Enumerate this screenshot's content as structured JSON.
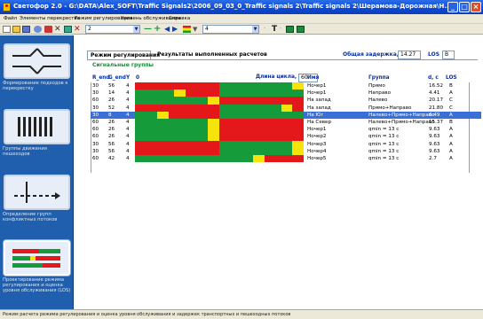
{
  "window": {
    "title": "Светофор 2.0 - G:\\DATA\\Alex_SOFT\\Traffic Signals2\\2006_09_03_0_Traffic signals 2\\Traffic signals 2\\Шерамова-Дорожная\\Н..."
  },
  "menu": [
    "Файл",
    "Элементы перекрестка",
    "Режим регулирования",
    "Уровень обслуживания",
    "Справка"
  ],
  "toolbar": {
    "combo1_value": "2",
    "combo2_value": "4"
  },
  "sidebar": [
    {
      "label": "Формирование подходов к перекрестку"
    },
    {
      "label": "Группы движения пешеходов"
    },
    {
      "label": "Определение групп конфликтных потоков"
    },
    {
      "label": "Проектирование режима регулирования и оценка уровня обслуживания (LOS)"
    }
  ],
  "tabs": {
    "active": "Режим регулирования",
    "results": "Результаты выполненных расчетов"
  },
  "summary": {
    "delay_label": "Общая задержка, с",
    "delay_value": "14.27",
    "los_label": "LOS",
    "los_value": "B"
  },
  "section_title": "Сигнальные группы",
  "columns": {
    "r_end": "R_end",
    "g_end": "G_end",
    "y": "Y",
    "zero": "0",
    "name": "Имя",
    "group": "Группа",
    "d": "d, c",
    "los": "LOS"
  },
  "cycle": {
    "label": "Длина цикла, с",
    "value": "60"
  },
  "colors": {
    "red": "#e4171b",
    "green": "#169b3a",
    "yellow": "#f6e30c",
    "selection": "#3b6fd8"
  },
  "cycle_length": 60,
  "rows": [
    {
      "r_end": "30",
      "g_end": "56",
      "y": "4",
      "name": "Нoчер1",
      "group": "Прямо",
      "d": "16.52",
      "los": "B",
      "segments": [
        {
          "c": "red",
          "from": 0,
          "to": 30
        },
        {
          "c": "green",
          "from": 30,
          "to": 56
        },
        {
          "c": "yellow",
          "from": 56,
          "to": 60
        }
      ]
    },
    {
      "r_end": "30",
      "g_end": "14",
      "y": "4",
      "name": "Нoчер1",
      "group": "Направо",
      "d": "4.41",
      "los": "A",
      "segments": [
        {
          "c": "green",
          "from": 0,
          "to": 14
        },
        {
          "c": "yellow",
          "from": 14,
          "to": 18
        },
        {
          "c": "red",
          "from": 18,
          "to": 30
        },
        {
          "c": "green",
          "from": 30,
          "to": 60
        }
      ]
    },
    {
      "r_end": "60",
      "g_end": "26",
      "y": "4",
      "name": "На запад",
      "group": "Налево",
      "d": "20.17",
      "los": "C",
      "segments": [
        {
          "c": "green",
          "from": 0,
          "to": 26
        },
        {
          "c": "yellow",
          "from": 26,
          "to": 30
        },
        {
          "c": "red",
          "from": 30,
          "to": 60
        }
      ]
    },
    {
      "r_end": "30",
      "g_end": "52",
      "y": "4",
      "name": "На запад",
      "group": "Прямо+Направо",
      "d": "21.80",
      "los": "C",
      "segments": [
        {
          "c": "red",
          "from": 0,
          "to": 30
        },
        {
          "c": "green",
          "from": 30,
          "to": 52
        },
        {
          "c": "yellow",
          "from": 52,
          "to": 56
        },
        {
          "c": "red",
          "from": 56,
          "to": 60
        }
      ]
    },
    {
      "r_end": "30",
      "g_end": "8",
      "y": "4",
      "name": "На Юг",
      "group": "Налево+Прямо+Направо",
      "d": "6.49",
      "los": "A",
      "selected": true,
      "segments": [
        {
          "c": "green",
          "from": 0,
          "to": 8
        },
        {
          "c": "yellow",
          "from": 8,
          "to": 12
        },
        {
          "c": "red",
          "from": 12,
          "to": 30
        },
        {
          "c": "green",
          "from": 30,
          "to": 60
        }
      ]
    },
    {
      "r_end": "60",
      "g_end": "26",
      "y": "4",
      "name": "На Север",
      "group": "Налево+Прямо+Направо",
      "d": "15.37",
      "los": "B",
      "segments": [
        {
          "c": "green",
          "from": 0,
          "to": 26
        },
        {
          "c": "yellow",
          "from": 26,
          "to": 30
        },
        {
          "c": "red",
          "from": 30,
          "to": 60
        }
      ]
    },
    {
      "r_end": "60",
      "g_end": "26",
      "y": "4",
      "name": "Нoчер1",
      "group": "qmin = 13 c",
      "d": "9.63",
      "los": "A",
      "segments": [
        {
          "c": "green",
          "from": 0,
          "to": 26
        },
        {
          "c": "yellow",
          "from": 26,
          "to": 30
        },
        {
          "c": "red",
          "from": 30,
          "to": 60
        }
      ]
    },
    {
      "r_end": "60",
      "g_end": "26",
      "y": "4",
      "name": "Нoчер2",
      "group": "qmin = 13 c",
      "d": "9.63",
      "los": "A",
      "segments": [
        {
          "c": "green",
          "from": 0,
          "to": 26
        },
        {
          "c": "yellow",
          "from": 26,
          "to": 30
        },
        {
          "c": "red",
          "from": 30,
          "to": 60
        }
      ]
    },
    {
      "r_end": "30",
      "g_end": "56",
      "y": "4",
      "name": "Нoчер3",
      "group": "qmin = 13 c",
      "d": "9.63",
      "los": "A",
      "segments": [
        {
          "c": "red",
          "from": 0,
          "to": 30
        },
        {
          "c": "green",
          "from": 30,
          "to": 56
        },
        {
          "c": "yellow",
          "from": 56,
          "to": 60
        }
      ]
    },
    {
      "r_end": "30",
      "g_end": "56",
      "y": "4",
      "name": "Нoчер4",
      "group": "qmin = 13 c",
      "d": "9.63",
      "los": "A",
      "segments": [
        {
          "c": "red",
          "from": 0,
          "to": 30
        },
        {
          "c": "green",
          "from": 30,
          "to": 56
        },
        {
          "c": "yellow",
          "from": 56,
          "to": 60
        }
      ]
    },
    {
      "r_end": "60",
      "g_end": "42",
      "y": "4",
      "name": "Нoчер5",
      "group": "qmin = 13 c",
      "d": "2.7",
      "los": "A",
      "segments": [
        {
          "c": "green",
          "from": 0,
          "to": 42
        },
        {
          "c": "yellow",
          "from": 42,
          "to": 46
        },
        {
          "c": "red",
          "from": 46,
          "to": 60
        }
      ]
    }
  ],
  "status": "Режим расчета режима регулирования и оценка уровня обслуживания и задержек транспортных и пешеходных потоков"
}
